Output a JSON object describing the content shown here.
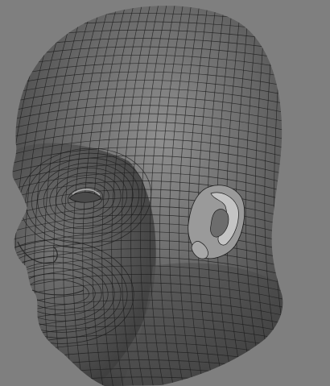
{
  "viewport": {
    "background_color": "#7f7f7f",
    "subject": "wireframe-head-model",
    "shading": {
      "base_light": "#8a8a8a",
      "base_mid": "#5f5f5f",
      "base_dark": "#3a3a3a",
      "wire_color": "#1c1c1c",
      "ear_highlight": "#bdbdbd"
    }
  }
}
